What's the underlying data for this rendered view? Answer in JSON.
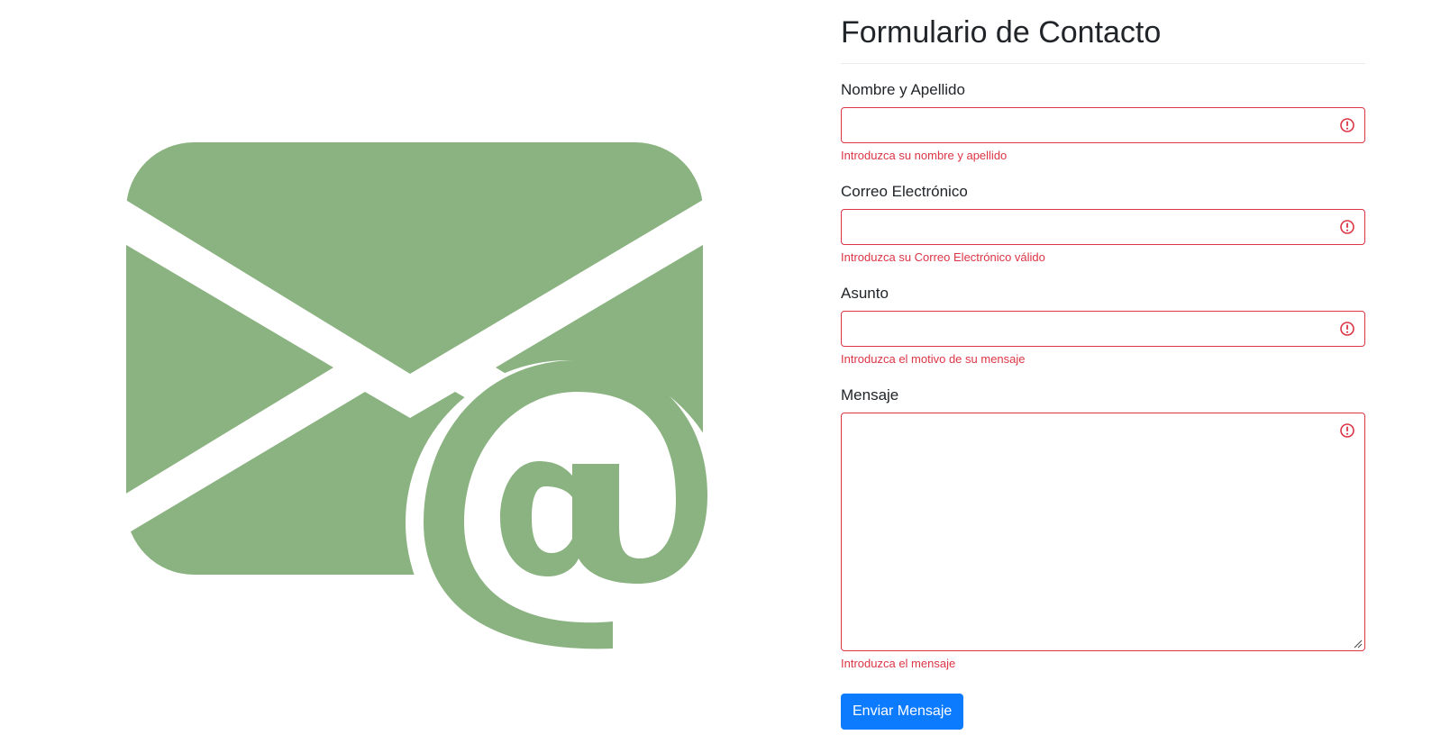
{
  "form": {
    "title": "Formulario de Contacto",
    "fields": [
      {
        "label": "Nombre y Apellido",
        "value": "",
        "error": "Introduzca su nombre y apellido"
      },
      {
        "label": "Correo Electrónico",
        "value": "",
        "error": "Introduzca su Correo Electrónico válido"
      },
      {
        "label": "Asunto",
        "value": "",
        "error": "Introduzca el motivo de su mensaje"
      },
      {
        "label": "Mensaje",
        "value": "",
        "error": "Introduzca el mensaje"
      }
    ],
    "submit_label": "Enviar Mensaje"
  },
  "colors": {
    "error": "#dc3545",
    "primary_button": "#0d7bfd",
    "illustration": "#8bb381"
  },
  "icons": {
    "illustration": "envelope-at-icon",
    "field_alert": "exclamation-circle-icon"
  }
}
